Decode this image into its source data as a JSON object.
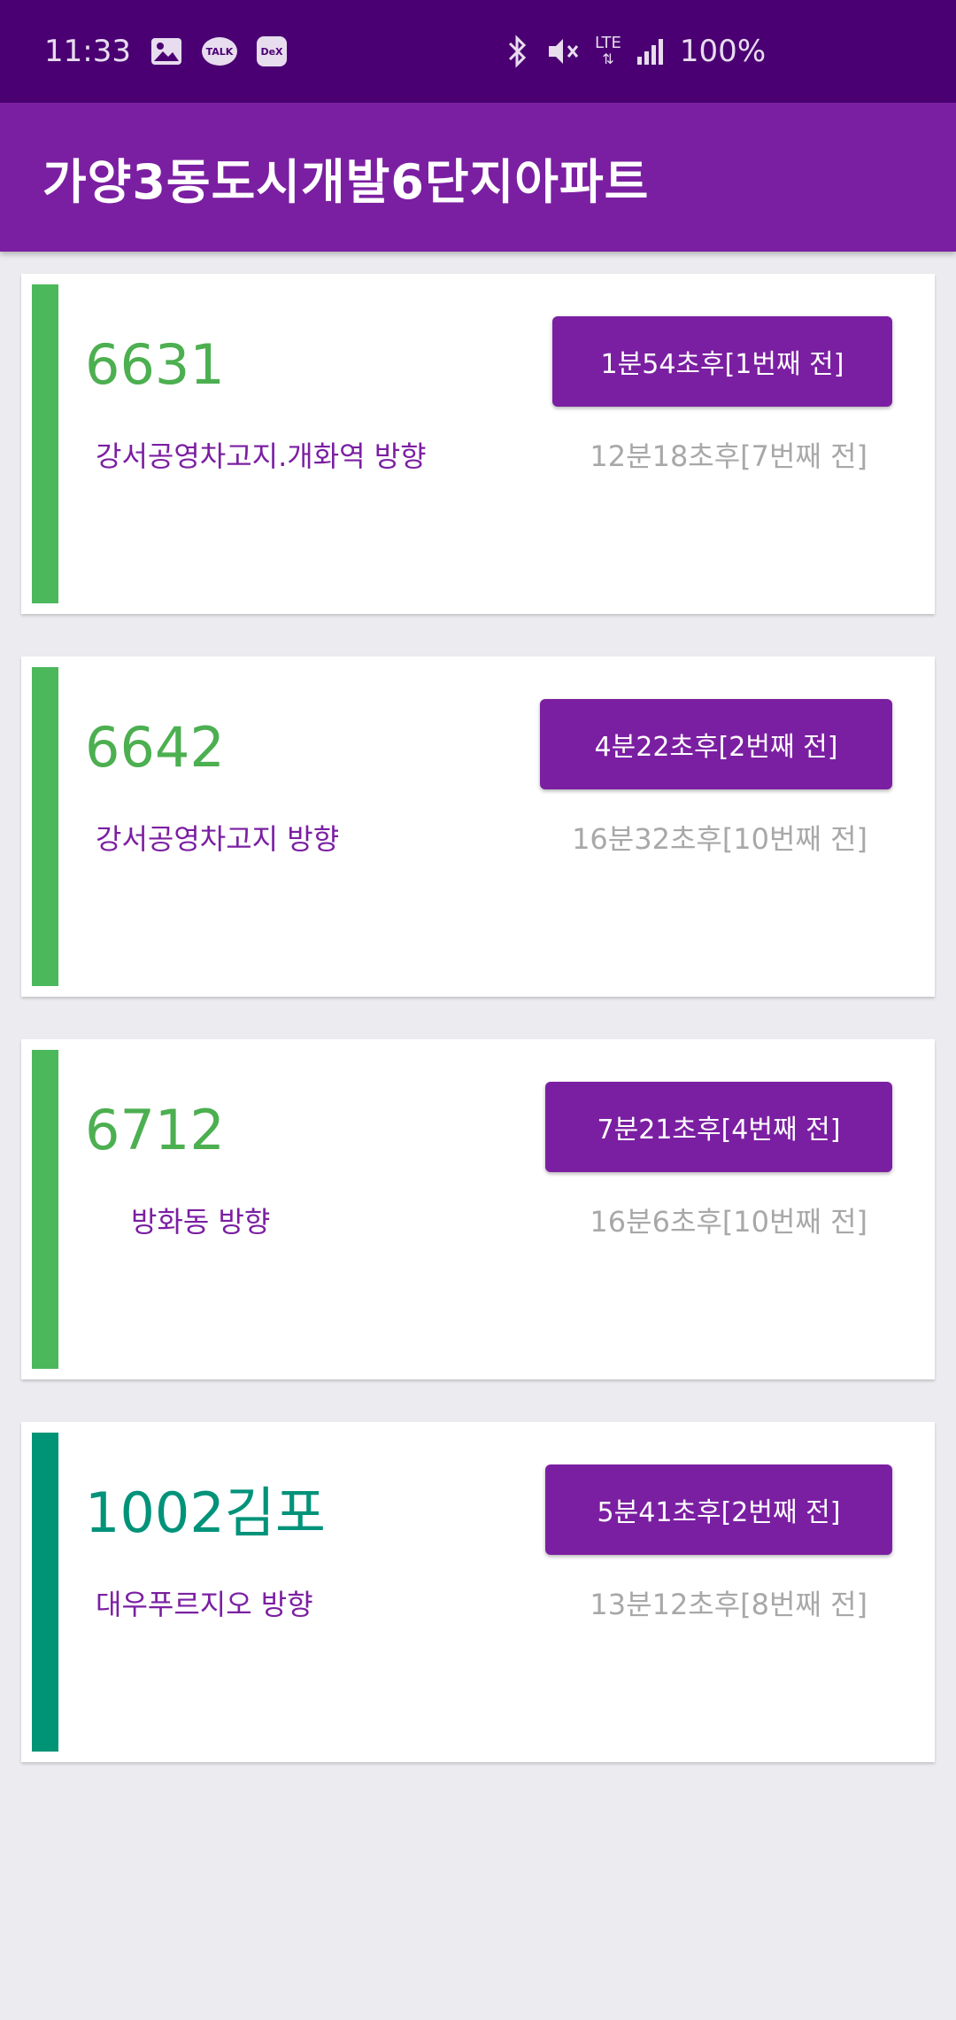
{
  "status_bar": {
    "time": "11:33",
    "talk_label": "TALK",
    "dex_label": "DeX",
    "network": "LTE",
    "battery": "100%",
    "icons": [
      "gallery-icon",
      "kakaotalk-icon",
      "dex-icon",
      "bluetooth-icon",
      "mute-icon",
      "lte-icon",
      "signal-icon"
    ]
  },
  "app_bar": {
    "title": "가양3동도시개발6단지아파트"
  },
  "routes": [
    {
      "number": "6631",
      "direction": "강서공영차고지.개화역 방향",
      "first_arrival": "1분54초후[1번째 전]",
      "second_arrival": "12분18초후[7번째 전]",
      "stripe_color": "#4cb85c",
      "number_color": "#4caf50"
    },
    {
      "number": "6642",
      "direction": "강서공영차고지 방향",
      "first_arrival": "4분22초후[2번째 전]",
      "second_arrival": "16분32초후[10번째 전]",
      "stripe_color": "#4cb85c",
      "number_color": "#4caf50"
    },
    {
      "number": "6712",
      "direction": "방화동 방향",
      "first_arrival": "7분21초후[4번째 전]",
      "second_arrival": "16분6초후[10번째 전]",
      "stripe_color": "#4cb85c",
      "number_color": "#4caf50"
    },
    {
      "number": "1002김포",
      "direction": "대우푸르지오 방향",
      "first_arrival": "5분41초후[2번째 전]",
      "second_arrival": "13분12초후[8번째 전]",
      "stripe_color": "#009477",
      "number_color": "#00937a"
    }
  ]
}
